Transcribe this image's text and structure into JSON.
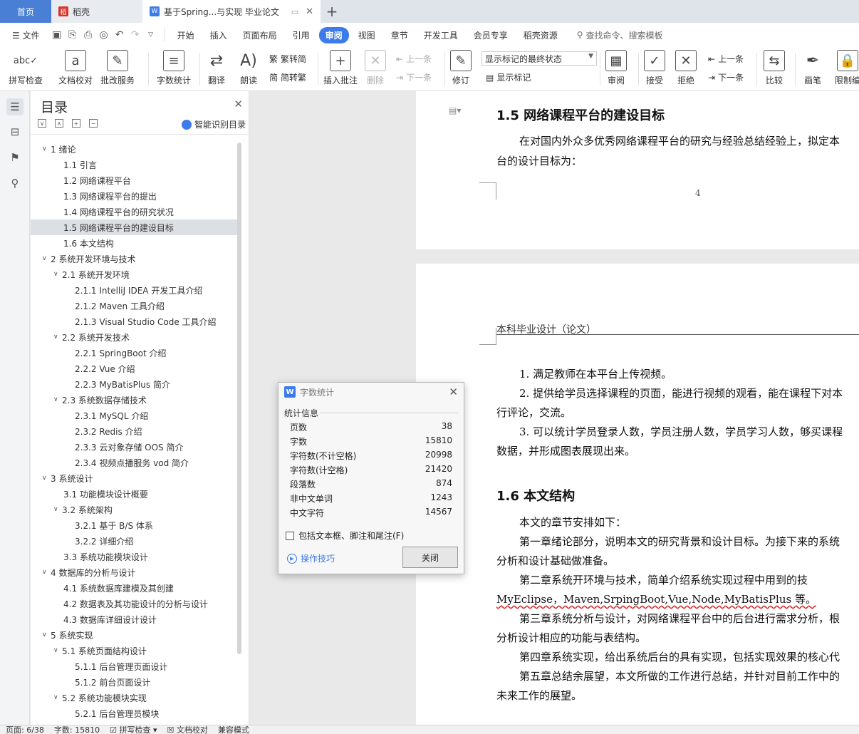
{
  "tabs": {
    "home": "首页",
    "daoke": "稻壳",
    "doc": "基于Spring...与实现 毕业论文"
  },
  "menu": {
    "file": "文件",
    "items": [
      "开始",
      "插入",
      "页面布局",
      "引用",
      "审阅",
      "视图",
      "章节",
      "开发工具",
      "会员专享",
      "稻壳资源"
    ],
    "active": "审阅",
    "search": "查找命令、搜索模板"
  },
  "ribbon": {
    "spell": "拼写检查",
    "doc_check": "文档校对",
    "review_service": "批改服务",
    "word_count": "字数统计",
    "translate": "翻译",
    "read_aloud": "朗读",
    "to_trad": "繁转简",
    "to_simp": "简转繁",
    "insert_comment": "插入批注",
    "delete": "删除",
    "prev_comment": "上一条",
    "next_comment": "下一条",
    "track": "修订",
    "markup_state": "显示标记的最终状态",
    "show_markup": "显示标记",
    "review": "审阅",
    "accept": "接受",
    "reject": "拒绝",
    "prev": "上一条",
    "next": "下一条",
    "compare": "比较",
    "pen": "画笔",
    "restrict": "限制编"
  },
  "toc": {
    "title": "目录",
    "smart": "智能识别目录",
    "items": [
      {
        "text": "1  绪论",
        "level": 0,
        "caret": "∨"
      },
      {
        "text": "1.1  引言",
        "level": 1,
        "caret": ""
      },
      {
        "text": "1.2  网络课程平台",
        "level": 1,
        "caret": ""
      },
      {
        "text": "1.3  网络课程平台的提出",
        "level": 1,
        "caret": ""
      },
      {
        "text": "1.4  网络课程平台的研究状况",
        "level": 1,
        "caret": ""
      },
      {
        "text": "1.5  网络课程平台的建设目标",
        "level": 1,
        "caret": "",
        "selected": true
      },
      {
        "text": "1.6  本文结构",
        "level": 1,
        "caret": ""
      },
      {
        "text": "2  系统开发环境与技术",
        "level": 0,
        "caret": "∨"
      },
      {
        "text": "2.1  系统开发环境",
        "level": 1,
        "caret": "∨"
      },
      {
        "text": "2.1.1 IntelliJ IDEA  开发工具介绍",
        "level": 2,
        "caret": ""
      },
      {
        "text": "2.1.2 Maven 工具介绍",
        "level": 2,
        "caret": ""
      },
      {
        "text": "2.1.3 Visual Studio Code 工具介绍",
        "level": 2,
        "caret": ""
      },
      {
        "text": "2.2  系统开发技术",
        "level": 1,
        "caret": "∨"
      },
      {
        "text": "2.2.1 SpringBoot 介绍",
        "level": 2,
        "caret": ""
      },
      {
        "text": "2.2.2 Vue 介绍",
        "level": 2,
        "caret": ""
      },
      {
        "text": "2.2.3 MyBatisPlus 简介",
        "level": 2,
        "caret": ""
      },
      {
        "text": "2.3  系统数据存储技术",
        "level": 1,
        "caret": "∨"
      },
      {
        "text": "2.3.1 MySQL 介绍",
        "level": 2,
        "caret": ""
      },
      {
        "text": "2.3.2 Redis 介绍",
        "level": 2,
        "caret": ""
      },
      {
        "text": "2.3.3  云对象存储 OOS 简介",
        "level": 2,
        "caret": ""
      },
      {
        "text": "2.3.4  视频点播服务 vod 简介",
        "level": 2,
        "caret": ""
      },
      {
        "text": "3  系统设计",
        "level": 0,
        "caret": "∨"
      },
      {
        "text": "3.1  功能模块设计概要",
        "level": 1,
        "caret": ""
      },
      {
        "text": "3.2  系统架构",
        "level": 1,
        "caret": "∨"
      },
      {
        "text": "3.2.1  基于 B/S 体系",
        "level": 2,
        "caret": ""
      },
      {
        "text": "3.2.2  详细介绍",
        "level": 2,
        "caret": ""
      },
      {
        "text": "3.3  系统功能模块设计",
        "level": 1,
        "caret": ""
      },
      {
        "text": "4  数据库的分析与设计",
        "level": 0,
        "caret": "∨"
      },
      {
        "text": "4.1  系统数据库建模及其创建",
        "level": 1,
        "caret": ""
      },
      {
        "text": "4.2  数据表及其功能设计的分析与设计",
        "level": 1,
        "caret": ""
      },
      {
        "text": "4.3  数据库详细设计设计",
        "level": 1,
        "caret": ""
      },
      {
        "text": "5  系统实现",
        "level": 0,
        "caret": "∨"
      },
      {
        "text": "5.1  系统页面结构设计",
        "level": 1,
        "caret": "∨"
      },
      {
        "text": "5.1.1  后台管理页面设计",
        "level": 2,
        "caret": ""
      },
      {
        "text": "5.1.2 前台页面设计",
        "level": 2,
        "caret": ""
      },
      {
        "text": "5.2  系统功能模块实现",
        "level": 1,
        "caret": "∨"
      },
      {
        "text": "5.2.1  后台管理员模块",
        "level": 2,
        "caret": ""
      }
    ]
  },
  "doc": {
    "h15": "1.5  网络课程平台的建设目标",
    "p15a": "在对国内外众多优秀网络课程平台的研究与经验总结经验上，拟定本",
    "p15b": "台的设计目标为：",
    "page_num": "4",
    "header": "本科毕业设计（论文）",
    "l1": "1.  满足教师在本平台上传视频。",
    "l2a": "2.  提供给学员选择课程的页面，能进行视频的观看，能在课程下对本",
    "l2b": "行评论，交流。",
    "l3a": "3.  可以统计学员登录人数，学员注册人数，学员学习人数，够买课程",
    "l3b": "数据，并形成图表展现出来。",
    "h16": "1.6  本文结构",
    "p1": "本文的章节安排如下：",
    "p2a": "第一章绪论部分，说明本文的研究背景和设计目标。为接下来的系统",
    "p2b": "分析和设计基础做准备。",
    "p3a": "第二章系统开环境与技术，简单介绍系统实现过程中用到的技",
    "p3b": "MyEclipse，Maven,SrpingBoot,Vue,Node,MyBatisPlus 等。",
    "p4a": "第三章系统分析与设计，对网络课程平台中的后台进行需求分析，根",
    "p4b": "分析设计相应的功能与表结构。",
    "p5": "第四章系统实现，给出系统后台的具有实现，包括实现效果的核心代",
    "p6a": "第五章总结余展望，本文所做的工作进行总结，并针对目前工作中的",
    "p6b": "未来工作的展望。"
  },
  "dialog": {
    "title": "字数统计",
    "section": "统计信息",
    "rows": [
      {
        "label": "页数",
        "value": "38"
      },
      {
        "label": "字数",
        "value": "15810"
      },
      {
        "label": "字符数(不计空格)",
        "value": "20998"
      },
      {
        "label": "字符数(计空格)",
        "value": "21420"
      },
      {
        "label": "段落数",
        "value": "874"
      },
      {
        "label": "非中文单词",
        "value": "1243"
      },
      {
        "label": "中文字符",
        "value": "14567"
      }
    ],
    "checkbox": "包括文本框、脚注和尾注(F)",
    "tips": "操作技巧",
    "close": "关闭"
  },
  "status": {
    "page": "页面: 6/38",
    "words": "字数: 15810",
    "spell": "拼写检查",
    "doc_check": "文档校对",
    "compat": "兼容模式"
  }
}
